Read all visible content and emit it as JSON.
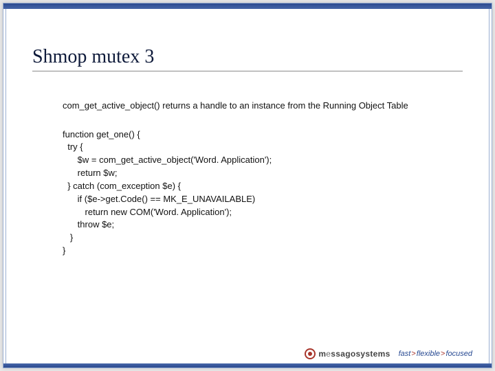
{
  "title": "Shmop mutex 3",
  "description": "com_get_active_object() returns a handle to an instance from the Running Object Table",
  "code": "function get_one() {\n  try {\n      $w = com_get_active_object('Word. Application');\n      return $w;\n  } catch (com_exception $e) {\n      if ($e->get.Code() == MK_E_UNAVAILABLE)\n         return new COM('Word. Application');\n      throw $e;\n   }\n}",
  "footer": {
    "brand_prefix": "m",
    "brand_mid": "e",
    "brand_suffix": "ssagosystems",
    "tag1": "fast",
    "tag2": "flexible",
    "tag3": "focused"
  }
}
